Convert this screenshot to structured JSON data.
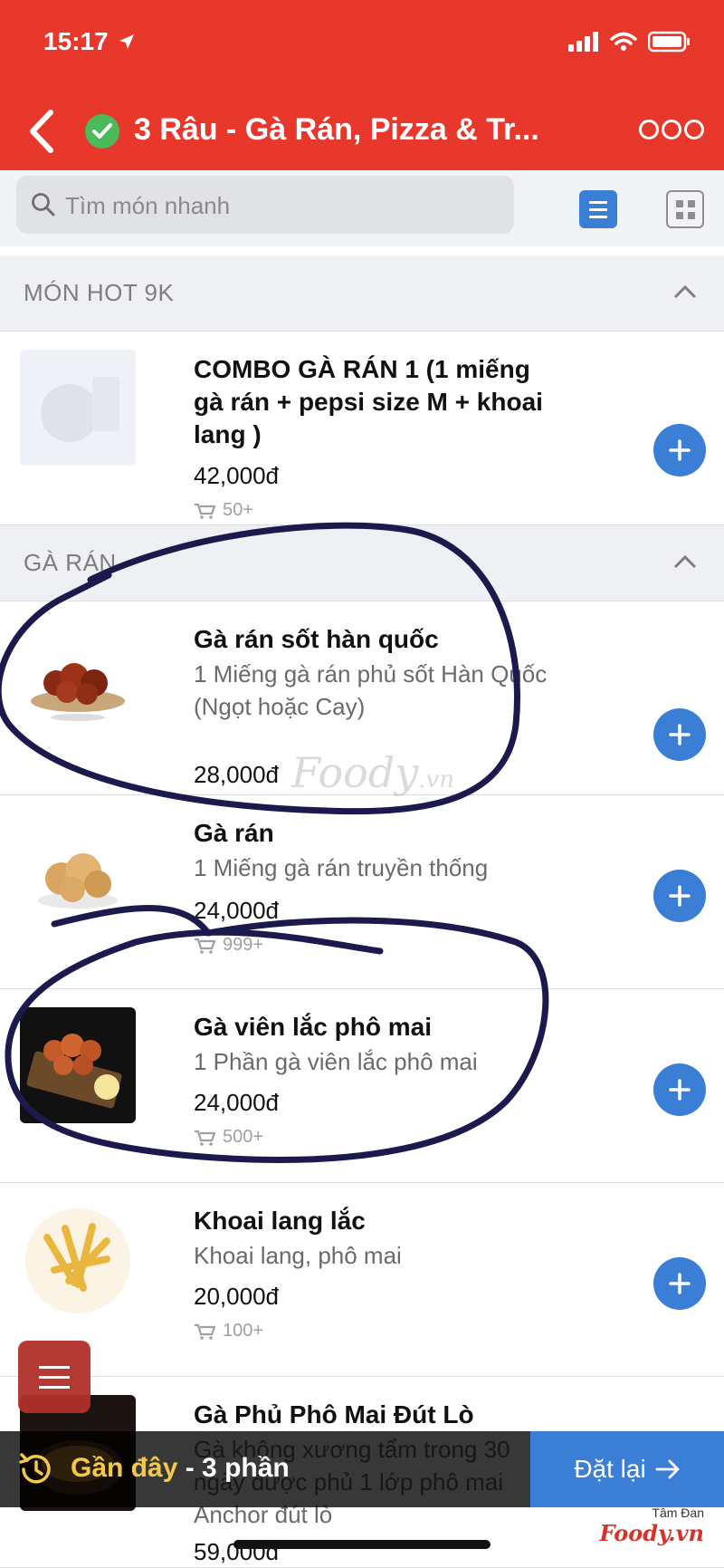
{
  "status_bar": {
    "time": "15:17"
  },
  "header": {
    "title": "3 Râu - Gà Rán, Pizza & Tr..."
  },
  "search": {
    "placeholder": "Tìm món nhanh"
  },
  "sections": [
    {
      "title": "MÓN HOT 9K"
    },
    {
      "title": "GÀ RÁN"
    }
  ],
  "items": [
    {
      "name": "COMBO GÀ RÁN 1 (1 miếng gà rán + pepsi size M + khoai lang )",
      "description": "",
      "price": "42,000đ",
      "sold": "50+"
    },
    {
      "name": "Gà rán sốt hàn quốc",
      "description": "1 Miếng gà rán phủ sốt Hàn Quốc (Ngọt hoặc Cay)",
      "price": "28,000đ",
      "sold": ""
    },
    {
      "name": "Gà rán",
      "description": "1 Miếng gà rán truyền thống",
      "price": "24,000đ",
      "sold": "999+"
    },
    {
      "name": "Gà viên lắc phô mai",
      "description": "1 Phần gà viên lắc phô mai",
      "price": "24,000đ",
      "sold": "500+"
    },
    {
      "name": "Khoai lang lắc",
      "description": "Khoai lang, phô mai",
      "price": "20,000đ",
      "sold": "100+"
    },
    {
      "name": "Gà Phủ Phô Mai Đút Lò",
      "description": "Gà không xương tẩm trong 30 ngày được phủ 1 lớp phô mai Anchor đút lò",
      "price": "59,000đ",
      "sold": ""
    }
  ],
  "bottom_bar": {
    "recent_label": "Gần đây",
    "recent_count": "- 3 phần",
    "reorder_label": "Đặt lại"
  },
  "watermark": {
    "brand": "Foody",
    "suffix": ".vn",
    "credit_author": "Tâm Đan",
    "credit_brand": "Foody.vn"
  },
  "colors": {
    "header_red": "#e8372b",
    "accent_blue": "#3b7ed6",
    "verified_green": "#4cba5b",
    "recent_yellow": "#f2c94c"
  }
}
